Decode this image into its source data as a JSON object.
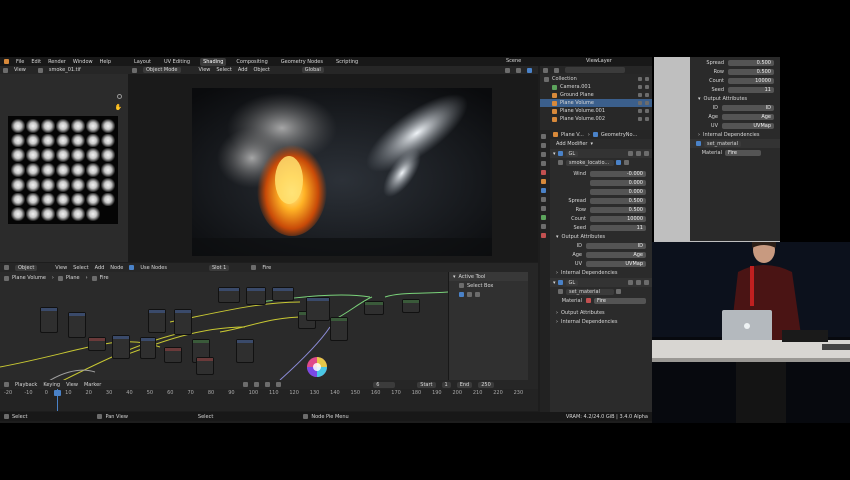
{
  "topbar": {
    "menus": [
      "File",
      "Edit",
      "Render",
      "Window",
      "Help"
    ],
    "workspaces": [
      "Layout",
      "UV Editing",
      "Shading",
      "Compositing",
      "Geometry Nodes",
      "Scripting"
    ],
    "active_workspace": "Shading",
    "scene": "Scene",
    "view_layer": "ViewLayer"
  },
  "image_editor": {
    "view_label": "View",
    "image_name": "smoke_01.tif",
    "flipbook_count": 48
  },
  "viewport": {
    "mode": "Object Mode",
    "menus": [
      "View",
      "Select",
      "Add",
      "Object"
    ],
    "orientation": "Global"
  },
  "node_editor": {
    "editor_type": "Object",
    "menus": [
      "View",
      "Select",
      "Add",
      "Node"
    ],
    "use_nodes_label": "Use Nodes",
    "slot": "Slot 1",
    "material": "Fire",
    "breadcrumb": [
      "Plane Volume",
      "Plane",
      "Fire"
    ],
    "active_tool_title": "Active Tool",
    "active_tool": "Select Box"
  },
  "timeline": {
    "menus": [
      "Playback",
      "Keying",
      "View",
      "Marker"
    ],
    "current_frame": "6",
    "start_label": "Start",
    "start": "1",
    "end_label": "End",
    "end": "250",
    "ruler": [
      "-20",
      "-10",
      "0",
      "10",
      "20",
      "30",
      "40",
      "50",
      "60",
      "70",
      "80",
      "90",
      "100",
      "110",
      "120",
      "130",
      "140",
      "150",
      "160",
      "170",
      "180",
      "190",
      "200",
      "210",
      "220",
      "230"
    ]
  },
  "statusbar": {
    "select": "Select",
    "pan": "Pan View",
    "select2": "Select",
    "node_pie": "Node Pie Menu",
    "version": "VRAM: 4.2/24.0 GiB | 3.4.0 Alpha"
  },
  "outliner": {
    "items": [
      {
        "name": "Collection",
        "selected": false
      },
      {
        "name": "Camera.001",
        "selected": false
      },
      {
        "name": "Ground Plane",
        "selected": false
      },
      {
        "name": "Plane Volume",
        "selected": true
      },
      {
        "name": "Plane Volume.001",
        "selected": false
      },
      {
        "name": "Plane Volume.002",
        "selected": false
      }
    ]
  },
  "properties": {
    "object": "Plane V...",
    "modifier": "GeometryNo...",
    "add_modifier": "Add Modifier",
    "gn1_name": "GL",
    "gn1_tree": "smoke_locatio...",
    "fields": [
      {
        "label": "Wind",
        "value": "-0.000"
      },
      {
        "label": "",
        "value": "0.000"
      },
      {
        "label": "",
        "value": "0.000"
      },
      {
        "label": "Spread",
        "value": "0.500"
      },
      {
        "label": "Row",
        "value": "0.500"
      },
      {
        "label": "Count",
        "value": "10000"
      },
      {
        "label": "Seed",
        "value": "11"
      }
    ],
    "output_attributes": "Output Attributes",
    "outputs": [
      {
        "label": "ID",
        "value": "ID"
      },
      {
        "label": "Age",
        "value": "Age"
      },
      {
        "label": "UV",
        "value": "UVMap"
      }
    ],
    "internal_dependencies": "Internal Dependencies",
    "gn2_name": "GL",
    "gn2_tree": "set_material",
    "material_label": "Material",
    "material_value": "Fire",
    "output_attributes2": "Output Attributes",
    "internal_dependencies2": "Internal Dependencies"
  },
  "slide": {
    "fields": [
      {
        "label": "Spread",
        "value": "0.500"
      },
      {
        "label": "Row",
        "value": "0.500"
      },
      {
        "label": "Count",
        "value": "10000"
      },
      {
        "label": "Seed",
        "value": "11"
      }
    ],
    "outputs": [
      {
        "label": "ID",
        "value": "ID"
      },
      {
        "label": "Age",
        "value": "Age"
      },
      {
        "label": "UV",
        "value": "UVMap"
      }
    ],
    "output_attributes": "Output Attributes",
    "internal_dependencies": "Internal Dependencies",
    "tree": "set_material",
    "material_label": "Material",
    "material_value": "Fire"
  },
  "colors": {
    "accent": "#4a82c8",
    "fire": "#ff9a1f",
    "background": "#1d1d1d"
  }
}
